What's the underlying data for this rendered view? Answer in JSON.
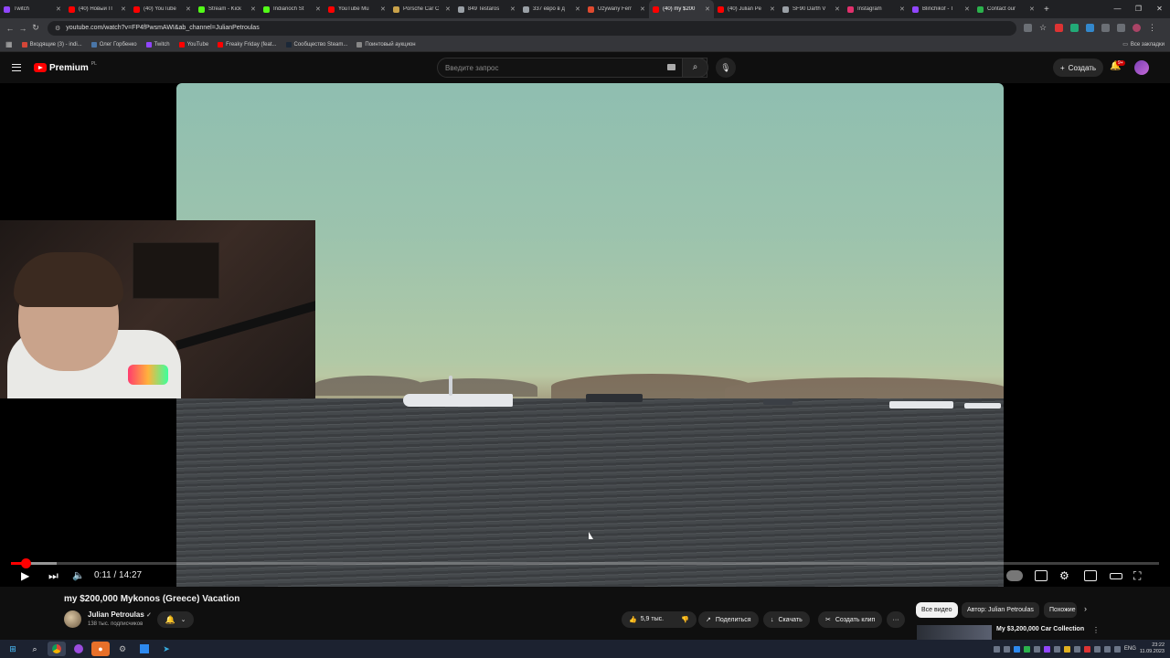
{
  "browser": {
    "tabs": [
      {
        "label": "Twitch",
        "color": "#9146ff",
        "active": false
      },
      {
        "label": "(40) Новый П",
        "color": "#ff0000",
        "active": false
      },
      {
        "label": "(40) YouTube",
        "color": "#ff0000",
        "active": false
      },
      {
        "label": "Stream - Kick",
        "color": "#53fc18",
        "active": false
      },
      {
        "label": "Indianoch St",
        "color": "#53fc18",
        "active": false
      },
      {
        "label": "YouTube Mu",
        "color": "#ff0000",
        "active": false
      },
      {
        "label": "Porsche Car C",
        "color": "#c9a24a",
        "active": false
      },
      {
        "label": "849 Testaros",
        "color": "#9aa0a6",
        "active": false
      },
      {
        "label": "337 евро в д",
        "color": "#9aa0a6",
        "active": false
      },
      {
        "label": "Używany Ferr",
        "color": "#e04a2f",
        "active": false
      },
      {
        "label": "(40) my $200",
        "color": "#ff0000",
        "active": true
      },
      {
        "label": "(40) Julian Pe",
        "color": "#ff0000",
        "active": false
      },
      {
        "label": "SF90 Darth V",
        "color": "#9aa0a6",
        "active": false
      },
      {
        "label": "Instagram",
        "color": "#e1306c",
        "active": false
      },
      {
        "label": "Blinchikof - T",
        "color": "#9146ff",
        "active": false
      },
      {
        "label": "Contact our",
        "color": "#2bb24c",
        "active": false
      }
    ],
    "new_tab": "+",
    "url": "youtube.com/watch?v=FP4fPwsmAWI&ab_channel=JulianPetroulas",
    "bookmarks": [
      {
        "label": "Входящие (3) - indi...",
        "color": "#d44638"
      },
      {
        "label": "Олег Горбенко",
        "color": "#4a76a8"
      },
      {
        "label": "Twitch",
        "color": "#9146ff"
      },
      {
        "label": "YouTube",
        "color": "#ff0000"
      },
      {
        "label": "Freaky Friday (feat...",
        "color": "#ff0000"
      },
      {
        "label": "Сообщество Steam...",
        "color": "#1b2838"
      },
      {
        "label": "Поинтовый аукцион",
        "color": "#888888"
      }
    ],
    "all_bookmarks": "Все закладки"
  },
  "youtube": {
    "logo_text": "Premium",
    "country_code": "PL",
    "search_placeholder": "Введите запрос",
    "create_label": "Создать",
    "notif_count": "9+",
    "accent": "#ff0000"
  },
  "player": {
    "time": "0:11 / 14:27",
    "progress_fraction": 0.0127,
    "buffered_fraction": 0.04
  },
  "video": {
    "title": "my $200,000 Mykonos (Greece) Vacation",
    "channel": "Julian Petroulas",
    "verified": "✓",
    "subscribers": "138 тыс. подписчиков",
    "likes": "5,9 тыс.",
    "share": "Поделиться",
    "download": "Скачать",
    "clip": "Создать клип",
    "more": "···"
  },
  "sidebar": {
    "chips": [
      "Все видео",
      "Автор: Julian Petroulas",
      "Похожие"
    ],
    "rec_title": "My $3,200,000 Car Collection"
  },
  "taskbar": {
    "lang": "ENG",
    "time": "23:22",
    "date": "11.09.2023"
  }
}
